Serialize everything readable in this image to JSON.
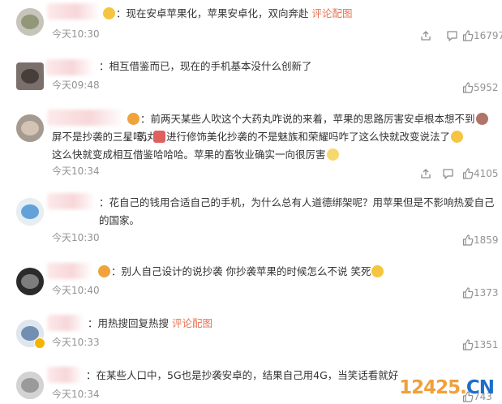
{
  "comments": [
    {
      "avatar_colors": [
        "#c7c4bb",
        "#8a8f6d"
      ],
      "text": "现在安卓苹果化，苹果安卓化，双向奔赴",
      "link": "评论配图",
      "time": "今天10:30",
      "likes": "16797"
    },
    {
      "avatar_colors": [
        "#7a6f6b",
        "#3e3633"
      ],
      "text": "相互借鉴而已，现在的手机基本没什么创新了",
      "link": "",
      "time": "今天09:48",
      "likes": "5952"
    },
    {
      "avatar_colors": [
        "#a59a8f",
        "#d9cabb"
      ],
      "text": "前两天某些人吹这个大药丸咋说的来着，苹果的思路厉害安卓根本想不到",
      "text2": "。药丸屏不是抄袭的三星吗，对",
      "text3": "进行修饰美化抄袭的不是魅族和荣耀吗咋了这么快就改变说法了",
      "text4": "这么快就变成相互借鉴哈哈哈。苹果的畜牧业确实一向很厉害",
      "time": "今天10:34",
      "likes": "4105"
    },
    {
      "avatar_colors": [
        "#e7eef3",
        "#4b94d4"
      ],
      "text": "花自己的钱用合适自己的手机，为什么总有人道德绑架呢？用苹果但是不影响热爱自己的国家。",
      "link": "",
      "time": "今天10:30",
      "likes": "1859"
    },
    {
      "avatar_colors": [
        "#2b2b2b",
        "#8c8c8c"
      ],
      "text": "别人自己设计的说抄袭 你抄袭苹果的时候怎么不说 笑死",
      "link": "",
      "time": "今天10:40",
      "likes": "1373"
    },
    {
      "avatar_colors": [
        "#dfe6ee",
        "#5e7fa8"
      ],
      "text": "用热搜回复热搜",
      "link": "评论配图",
      "time": "今天10:33",
      "likes": "1351"
    },
    {
      "avatar_colors": [
        "#d3d3d3",
        "#8f8f8f"
      ],
      "text": "在某些人口中，5G也是抄袭安卓的，结果自己用4G，当笑话看就好",
      "link": "",
      "time": "今天10:34",
      "likes": "743"
    }
  ],
  "icons": {
    "share": "share-icon",
    "reply": "comment-icon",
    "like": "thumbs-up-icon"
  },
  "watermark": {
    "digits": "12425",
    "dot": ".",
    "cn": "CN"
  },
  "colors": {
    "link": "#eb7350",
    "meta": "#939393",
    "text": "#333333"
  }
}
